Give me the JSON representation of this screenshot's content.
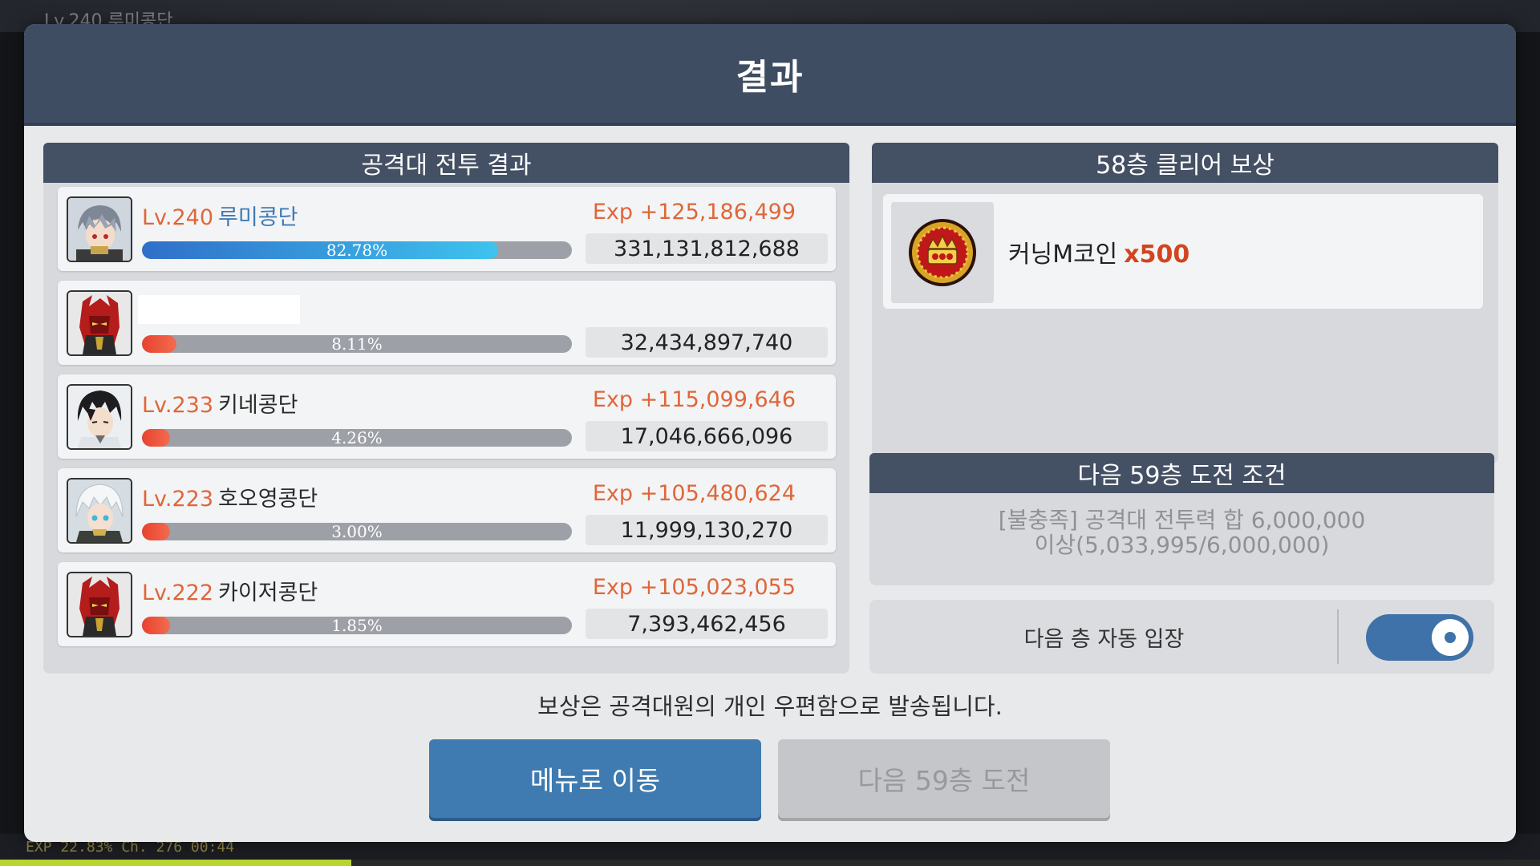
{
  "background": {
    "player_name": "Lv.240 루미콩단",
    "exp_status": "EXP  22.83%   Ch. 276  00:44",
    "exp_fraction": 0.2283
  },
  "dialog": {
    "title": "결과"
  },
  "battle_results": {
    "title": "공격대 전투 결과",
    "members": [
      {
        "level": "Lv.240",
        "name": "루미콩단",
        "level_color": "#e0663a",
        "name_color": "#3f79b6",
        "exp": "Exp +125,186,499",
        "percent_label": "82.78%",
        "percent": 82.78,
        "bar_color": "blue",
        "power": "331,131,812,688",
        "avatar": "silver-hair-avatar",
        "redacted": false
      },
      {
        "level": "",
        "name": "",
        "level_color": "#e0663a",
        "name_color": "#2a2a2a",
        "exp": "",
        "percent_label": "8.11%",
        "percent": 8.11,
        "bar_color": "red",
        "power": "32,434,897,740",
        "avatar": "red-armor-avatar",
        "redacted": true
      },
      {
        "level": "Lv.233",
        "name": "키네콩단",
        "level_color": "#e0663a",
        "name_color": "#2a2a2a",
        "exp": "Exp +115,099,646",
        "percent_label": "4.26%",
        "percent": 4.26,
        "bar_color": "red",
        "power": "17,046,666,096",
        "avatar": "dark-hair-avatar",
        "redacted": false
      },
      {
        "level": "Lv.223",
        "name": "호오영콩단",
        "level_color": "#e0663a",
        "name_color": "#2a2a2a",
        "exp": "Exp +105,480,624",
        "percent_label": "3.00%",
        "percent": 3.0,
        "bar_color": "red",
        "power": "11,999,130,270",
        "avatar": "white-hair-avatar",
        "redacted": false
      },
      {
        "level": "Lv.222",
        "name": "카이저콩단",
        "level_color": "#e0663a",
        "name_color": "#2a2a2a",
        "exp": "Exp +105,023,055",
        "percent_label": "1.85%",
        "percent": 1.85,
        "bar_color": "red",
        "power": "7,393,462,456",
        "avatar": "red-armor-avatar",
        "redacted": false
      }
    ]
  },
  "clear_reward": {
    "title": "58층 클리어 보상",
    "item_name": "커닝M코인",
    "item_qty": "x500",
    "icon": "cunning-coin-icon"
  },
  "next_condition": {
    "title": "다음 59층 도전 조건",
    "line1": "[불충족] 공격대 전투력 합 6,000,000",
    "line2": "이상(5,033,995/6,000,000)"
  },
  "auto_enter": {
    "label": "다음 층 자동 입장",
    "enabled": true
  },
  "notice": "보상은 공격대원의 개인 우편함으로 발송됩니다.",
  "buttons": {
    "menu": "메뉴로 이동",
    "next": "다음 59층 도전"
  },
  "colors": {
    "header": "#3f4d62",
    "panel_head": "#445064",
    "accent_blue": "#3f7bb0",
    "exp_orange": "#e0663a",
    "qty_red": "#d2451e"
  }
}
